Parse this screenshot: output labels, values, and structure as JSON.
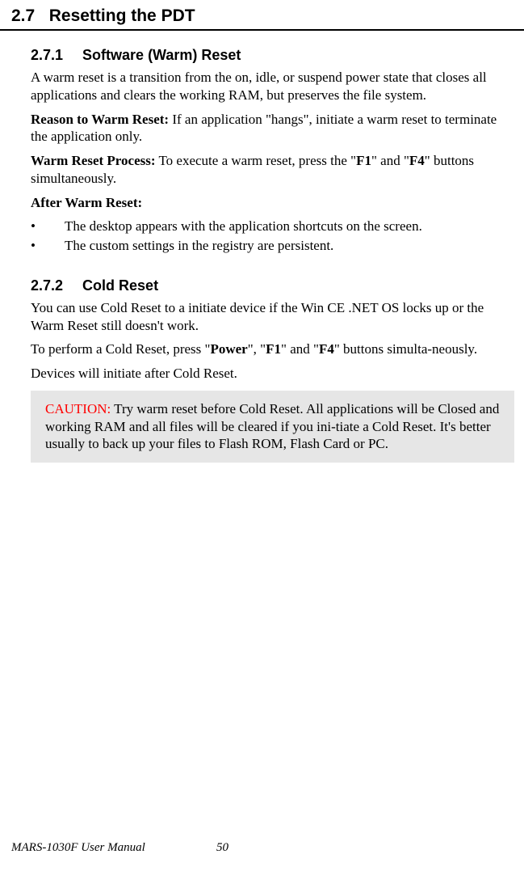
{
  "section": {
    "number": "2.7",
    "title": "Resetting the PDT"
  },
  "sub1": {
    "number": "2.7.1",
    "title": "Software (Warm) Reset",
    "para1": "A warm reset is a transition from the on, idle, or suspend power state that closes all applications and clears the working RAM, but preserves the file system.",
    "reason_label": "Reason to Warm Reset:",
    "reason_text": " If an application \"hangs\", initiate a warm reset to terminate the application only.",
    "process_label": "Warm Reset Process:",
    "process_text_a": " To execute a warm reset, press the \"",
    "process_key1": "F1",
    "process_text_b": "\" and \"",
    "process_key2": "F4",
    "process_text_c": "\" buttons simultaneously.",
    "after_label": "After Warm Reset:",
    "bullets": [
      "The desktop appears with the application shortcuts on the screen.",
      "The custom settings in the registry are persistent."
    ]
  },
  "sub2": {
    "number": "2.7.2",
    "title": "Cold Reset",
    "para1": "You can use Cold Reset to a initiate device if the Win CE .NET OS locks up or the Warm Reset still doesn't work.",
    "para2_a": "To perform a Cold Reset, press \"",
    "para2_key1": "Power",
    "para2_b": "\", \"",
    "para2_key2": "F1",
    "para2_c": "\" and \"",
    "para2_key3": "F4",
    "para2_d": "\" buttons simulta-neously.",
    "para3": "Devices will initiate after Cold Reset.",
    "caution_label": "CAUTION:",
    "caution_text": " Try warm reset before Cold Reset. All applications will be Closed and working RAM and all files will be cleared if you ini-tiate a Cold Reset. It's better usually to back up your files to Flash ROM, Flash Card or PC."
  },
  "footer": {
    "manual": "MARS-1030F User Manual",
    "page": "50"
  }
}
